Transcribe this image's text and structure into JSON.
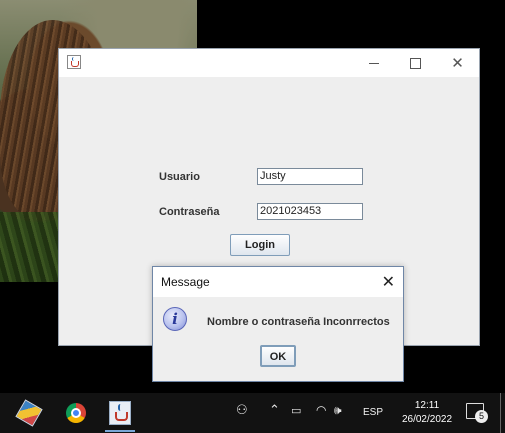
{
  "main_window": {
    "title": "",
    "usuario_label": "Usuario",
    "usuario_value": "Justy",
    "password_label": "Contraseña",
    "password_value": "2021023453",
    "login_button": "Login",
    "controls": {
      "minimize": "minimize-icon",
      "maximize": "maximize-icon",
      "close": "close-icon"
    }
  },
  "dialog": {
    "title": "Message",
    "message": "Nombre o contraseña Inconrrectos",
    "ok_button": "OK",
    "icon": "info-icon"
  },
  "taskbar": {
    "apps": [
      "virtualbox-icon",
      "chrome-icon",
      "java-app-icon"
    ],
    "language": "ESP",
    "time": "12:11",
    "date": "26/02/2022",
    "notifications_count": "5"
  }
}
